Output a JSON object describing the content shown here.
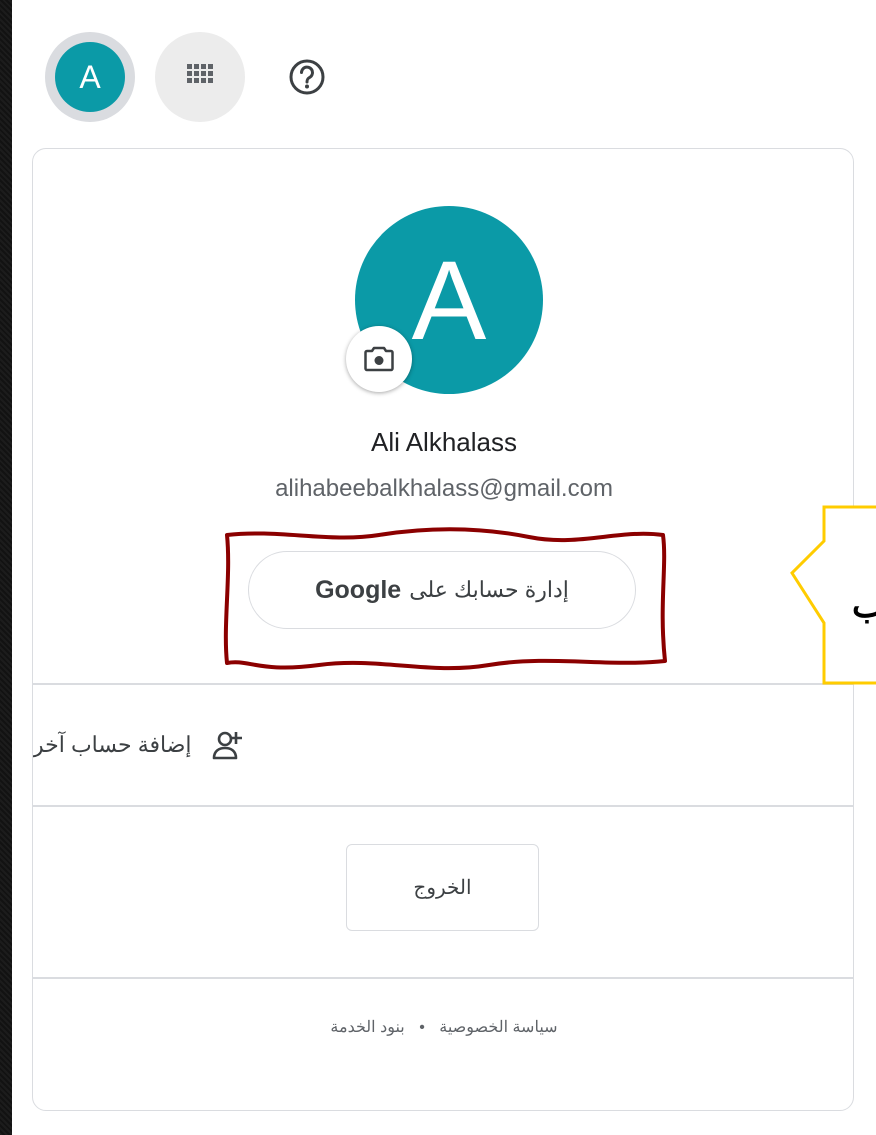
{
  "topbar": {
    "avatar_letter": "A"
  },
  "account": {
    "avatar_letter": "A",
    "name": "Ali Alkhalass",
    "email": "alihabeebalkhalass@gmail.com",
    "manage_label": "إدارة حسابك على",
    "manage_brand": "Google"
  },
  "add_account_label": "إضافة حساب آخر",
  "signout_label": "الخروج",
  "footer": {
    "privacy": "سياسة الخصوصية",
    "separator": "•",
    "terms": "بنود الخدمة"
  },
  "callout": {
    "text": "ب"
  },
  "colors": {
    "avatar": "#0b9aa7",
    "highlight": "#8b0000",
    "callout_border": "#ffcc00"
  }
}
